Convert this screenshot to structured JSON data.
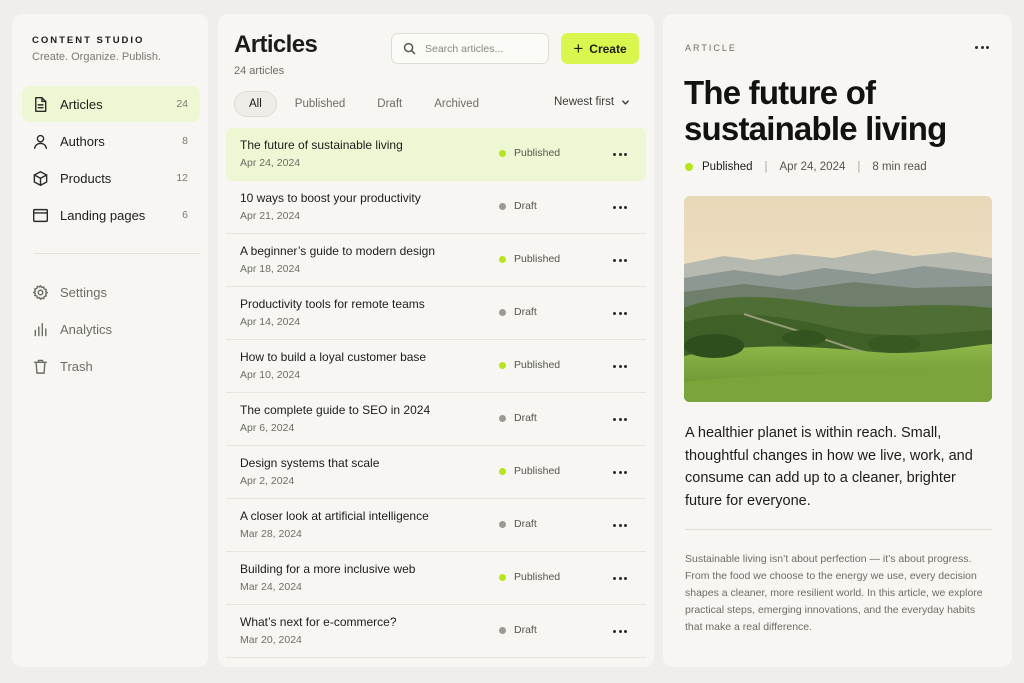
{
  "sidebar": {
    "brand": "CONTENT STUDIO",
    "tagline": "Create. Organize. Publish.",
    "primary": [
      {
        "label": "Articles",
        "count": "24",
        "icon": "document-icon"
      },
      {
        "label": "Authors",
        "count": "8",
        "icon": "user-icon"
      },
      {
        "label": "Products",
        "count": "12",
        "icon": "box-icon"
      },
      {
        "label": "Landing pages",
        "count": "6",
        "icon": "browser-window-icon"
      }
    ],
    "secondary": [
      {
        "label": "Settings",
        "icon": "gear-icon"
      },
      {
        "label": "Analytics",
        "icon": "bar-chart-icon"
      },
      {
        "label": "Trash",
        "icon": "trash-icon"
      }
    ]
  },
  "list": {
    "title": "Articles",
    "count_label": "24 articles",
    "search_placeholder": "Search articles...",
    "create_label": "Create",
    "tabs": [
      "All",
      "Published",
      "Draft",
      "Archived"
    ],
    "sort_label": "Newest first",
    "rows": [
      {
        "title": "The future of sustainable living",
        "date": "Apr 24, 2024",
        "status": "Published"
      },
      {
        "title": "10 ways to boost your productivity",
        "date": "Apr 21, 2024",
        "status": "Draft"
      },
      {
        "title": "A beginner’s guide to modern design",
        "date": "Apr 18, 2024",
        "status": "Published"
      },
      {
        "title": "Productivity tools for remote teams",
        "date": "Apr 14, 2024",
        "status": "Draft"
      },
      {
        "title": "How to build a loyal customer base",
        "date": "Apr 10, 2024",
        "status": "Published"
      },
      {
        "title": "The complete guide to SEO in 2024",
        "date": "Apr 6, 2024",
        "status": "Draft"
      },
      {
        "title": "Design systems that scale",
        "date": "Apr 2, 2024",
        "status": "Published"
      },
      {
        "title": "A closer look at artificial intelligence",
        "date": "Mar 28, 2024",
        "status": "Draft"
      },
      {
        "title": "Building for a more inclusive web",
        "date": "Mar 24, 2024",
        "status": "Published"
      },
      {
        "title": "What’s next for e-commerce?",
        "date": "Mar 20, 2024",
        "status": "Draft"
      }
    ]
  },
  "detail": {
    "kicker": "ARTICLE",
    "title": "The future of sustainable living",
    "status": "Published",
    "date": "Apr 24, 2024",
    "read_time": "8 min read",
    "lede": "A healthier planet is within reach. Small, thoughtful changes in how we live, work, and consume can add up to a cleaner, brighter future for everyone.",
    "body": "Sustainable living isn’t about perfection — it’s about progress. From the food we choose to the energy we use, every decision shapes a cleaner, more resilient world. In this article, we explore practical steps, emerging innovations, and the everyday habits that make a real difference."
  },
  "colors": {
    "accent": "#d9f64f",
    "active_bg": "#eef7d4",
    "published": "#b5e61d",
    "draft": "#9b9b95"
  }
}
